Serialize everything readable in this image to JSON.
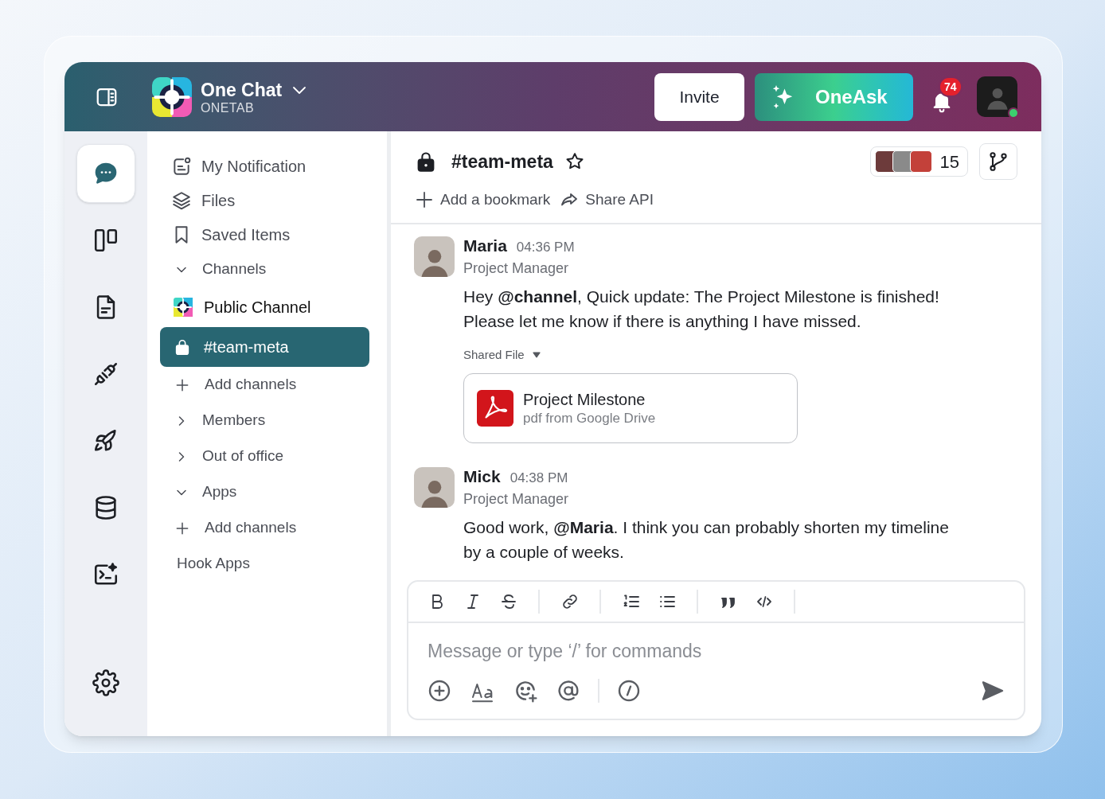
{
  "header": {
    "app_name": "One Chat",
    "workspace": "ONETAB",
    "invite": "Invite",
    "oneask": "OneAsk",
    "notification_count": "74",
    "online": true
  },
  "rail": [
    {
      "kind": "chat",
      "selected": true
    },
    {
      "kind": "board",
      "selected": false
    },
    {
      "kind": "document",
      "selected": false
    },
    {
      "kind": "plug",
      "selected": false
    },
    {
      "kind": "rocket",
      "selected": false
    },
    {
      "kind": "database",
      "selected": false
    },
    {
      "kind": "terminal",
      "selected": false
    }
  ],
  "rail_bottom": [
    {
      "kind": "settings",
      "selected": false
    }
  ],
  "nav": [
    {
      "kind": "link",
      "label": "My Notification"
    },
    {
      "kind": "link",
      "label": "Files"
    },
    {
      "kind": "link",
      "label": "Saved Items"
    },
    {
      "kind": "section",
      "label": "Channels",
      "expanded": true,
      "children": [
        {
          "kind": "workspace",
          "label": "Public Channel",
          "selected": false
        },
        {
          "kind": "channel",
          "label": "#team-meta",
          "selected": true
        },
        {
          "kind": "add",
          "label": "Add channels"
        }
      ]
    },
    {
      "kind": "section",
      "label": "Members",
      "expanded": false
    },
    {
      "kind": "section",
      "label": "Out of office",
      "expanded": false
    },
    {
      "kind": "section",
      "label": "Apps",
      "expanded": true,
      "children": [
        {
          "kind": "add",
          "label": "Add channels"
        },
        {
          "kind": "plain",
          "label": "Hook Apps"
        }
      ]
    }
  ],
  "channel": {
    "name": "#team-meta",
    "starred": false,
    "member_count": "15",
    "bookmark": "Add a bookmark",
    "share": "Share API"
  },
  "messages": [
    {
      "author": "Maria",
      "time": "04:36 PM",
      "role": "Project Manager",
      "text": "Hey **@channel**, Quick update: The Project Milestone is finished! Please let me know if there is anything I have missed.",
      "attachment": {
        "label": "Shared File",
        "expanded": true,
        "title": "Project Milestone",
        "subtitle": "pdf from Google Drive"
      }
    },
    {
      "author": "Mick",
      "time": "04:38 PM",
      "role": "Project Manager",
      "text": "Good work, **@Maria**. I think you can probably shorten my timeline by a couple of weeks."
    }
  ],
  "composer": {
    "placeholder": "Message or type ‘/’ for commands"
  }
}
